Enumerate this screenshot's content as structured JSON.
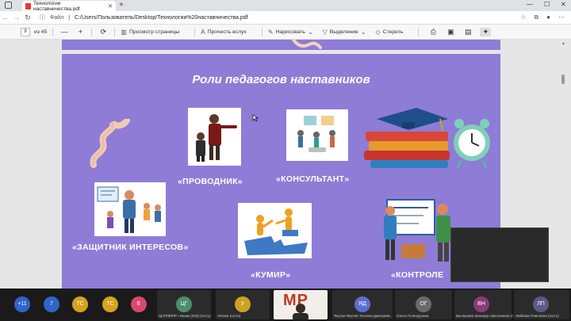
{
  "browser": {
    "tab_title": "Технологии наставничества.pdf",
    "new_tab": "+",
    "address_file_label": "Файл",
    "address_url": "C:/Users/Пользователь/Desktop/Технологии%20наставничества.pdf"
  },
  "pdf_toolbar": {
    "page_current": "9",
    "page_total": "из 45",
    "zoom_out": "—",
    "zoom_in": "+",
    "tools": [
      {
        "label": "Просмотр страницы",
        "icon": "page-view-icon"
      },
      {
        "label": "Прочесть вслух",
        "icon": "read-aloud-icon"
      },
      {
        "label": "Нарисовать",
        "icon": "draw-icon"
      },
      {
        "label": "Выделение",
        "icon": "highlight-icon"
      },
      {
        "label": "Стереть",
        "icon": "erase-icon"
      }
    ]
  },
  "slide": {
    "title": "Роли педагогов наставников",
    "roles": {
      "provodnik": "«ПРОВОДНИК»",
      "konsultant": "«КОНСУЛЬТАНТ»",
      "zashchitnik": "«ЗАЩИТНИК ИНТЕРЕСОВ»",
      "kumir": "«КУМИР»",
      "kontroler": "«КОНТРОЛЕ"
    },
    "colors": {
      "background": "#8e7cd6",
      "text": "#ffffff"
    }
  },
  "participants": {
    "overflow": "+11",
    "people": [
      {
        "initials": "7",
        "color": "#2f64c8",
        "name": ""
      },
      {
        "initials": "ТС",
        "color": "#d8a21e",
        "name": ""
      },
      {
        "initials": "ТС",
        "color": "#d8a21e",
        "name": ""
      },
      {
        "initials": "Е",
        "color": "#d8486e",
        "name": ""
      },
      {
        "initials": "ЦГ",
        "color": "#4a8f6a",
        "name": "ЦНППМПР г.Ишим (203) (гость)"
      },
      {
        "initials": "У",
        "color": "#c9a227",
        "name": "Уязова (гость)"
      },
      {
        "initials": "ЯД",
        "color": "#5a6fd0",
        "name": "Якусев Якусев Татьяна Дмитриев..."
      },
      {
        "initials": "ОГ",
        "color": "#6a6a6a",
        "name": "Ольга Голендухина"
      },
      {
        "initials": "ВН",
        "color": "#8b3a78",
        "name": "Выпашева Зинаида Николаевна (г..."
      },
      {
        "initials": "ЛП",
        "color": "#5a5a8a",
        "name": "Лейбова Павловна (гость)"
      }
    ],
    "camera_overlay": "МР"
  }
}
